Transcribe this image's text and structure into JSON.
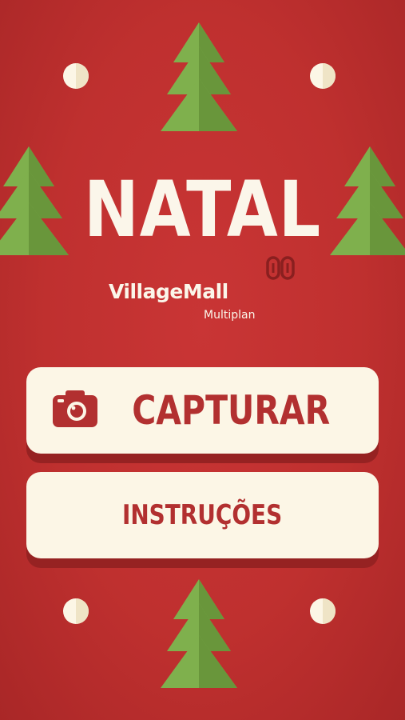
{
  "title": "NATAL",
  "brand": {
    "name": "VillageMall",
    "sub": "Multiplan"
  },
  "buttons": {
    "capture": "CAPTURAR",
    "instructions": "INSTRUÇÕES"
  },
  "icons": {
    "capture": "camera-icon",
    "brand": "multiplan-logo-icon"
  },
  "colors": {
    "background": "#c0302f",
    "cream": "#fcf6e6",
    "tree_light": "#7fb04d",
    "tree_dark": "#69963b",
    "button_text": "#b23030",
    "button_shadow": "#962222"
  }
}
